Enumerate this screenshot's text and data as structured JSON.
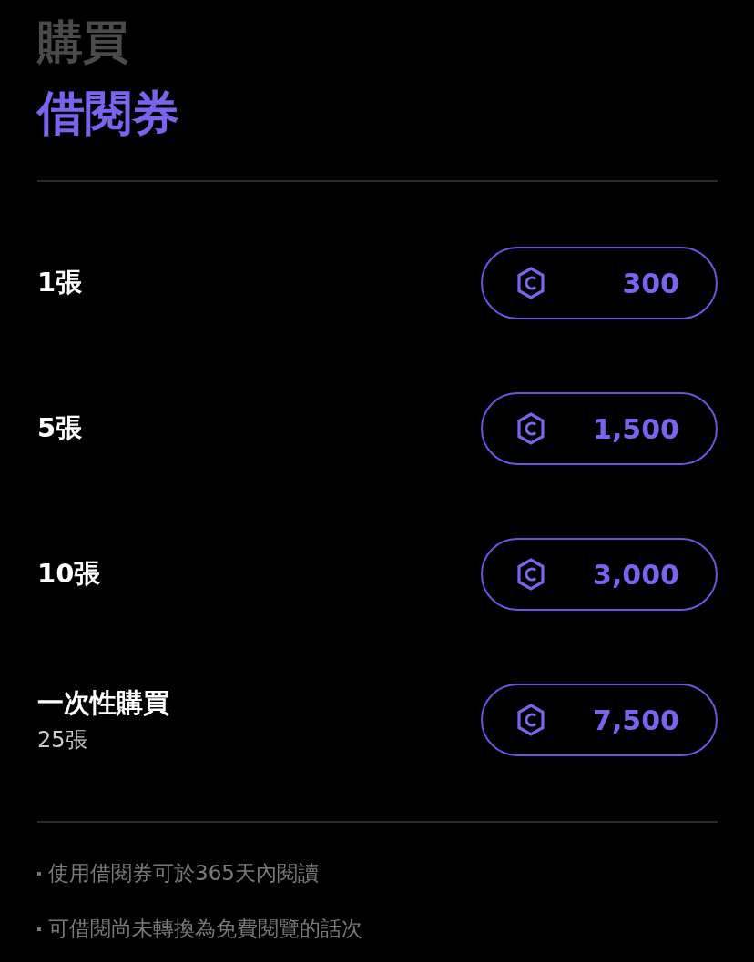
{
  "header": {
    "subtitle": "購買",
    "title": "借閱券"
  },
  "options": [
    {
      "label": "1張",
      "price": "300"
    },
    {
      "label": "5張",
      "price": "1,500"
    },
    {
      "label": "10張",
      "price": "3,000"
    },
    {
      "label": "一次性購買",
      "sublabel": "25張",
      "price": "7,500"
    }
  ],
  "notes": [
    "使用借閱券可於365天內閱讀",
    "可借閱尚未轉換為免費閱覽的話次"
  ]
}
